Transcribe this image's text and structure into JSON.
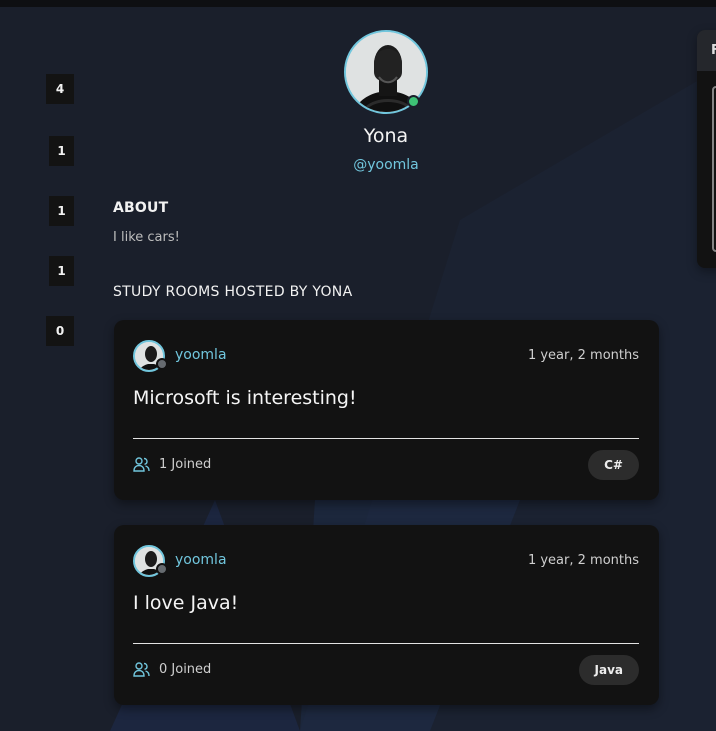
{
  "stats": [
    "4",
    "1",
    "1",
    "1",
    "0"
  ],
  "profile": {
    "name": "Yona",
    "handle": "@yoomla",
    "about_title": "ABOUT",
    "about_text": "I like cars!",
    "rooms_title": "STUDY ROOMS HOSTED BY YONA"
  },
  "rooms": [
    {
      "host": "yoomla",
      "time": "1 year, 2 months",
      "title": "Microsoft is interesting!",
      "joined": "1 Joined",
      "topic": "C#"
    },
    {
      "host": "yoomla",
      "time": "1 year, 2 months",
      "title": "I love Java!",
      "joined": "0 Joined",
      "topic": "Java"
    }
  ],
  "side_panel": {
    "header_visible": "F"
  },
  "colors": {
    "background": "#1a1f2b",
    "card": "#121212",
    "accent": "#71c6dd",
    "online": "#3ec276",
    "topic_pill": "#2c2c2c"
  },
  "icons": {
    "online_status": "online-status-icon",
    "people": "people-icon"
  }
}
